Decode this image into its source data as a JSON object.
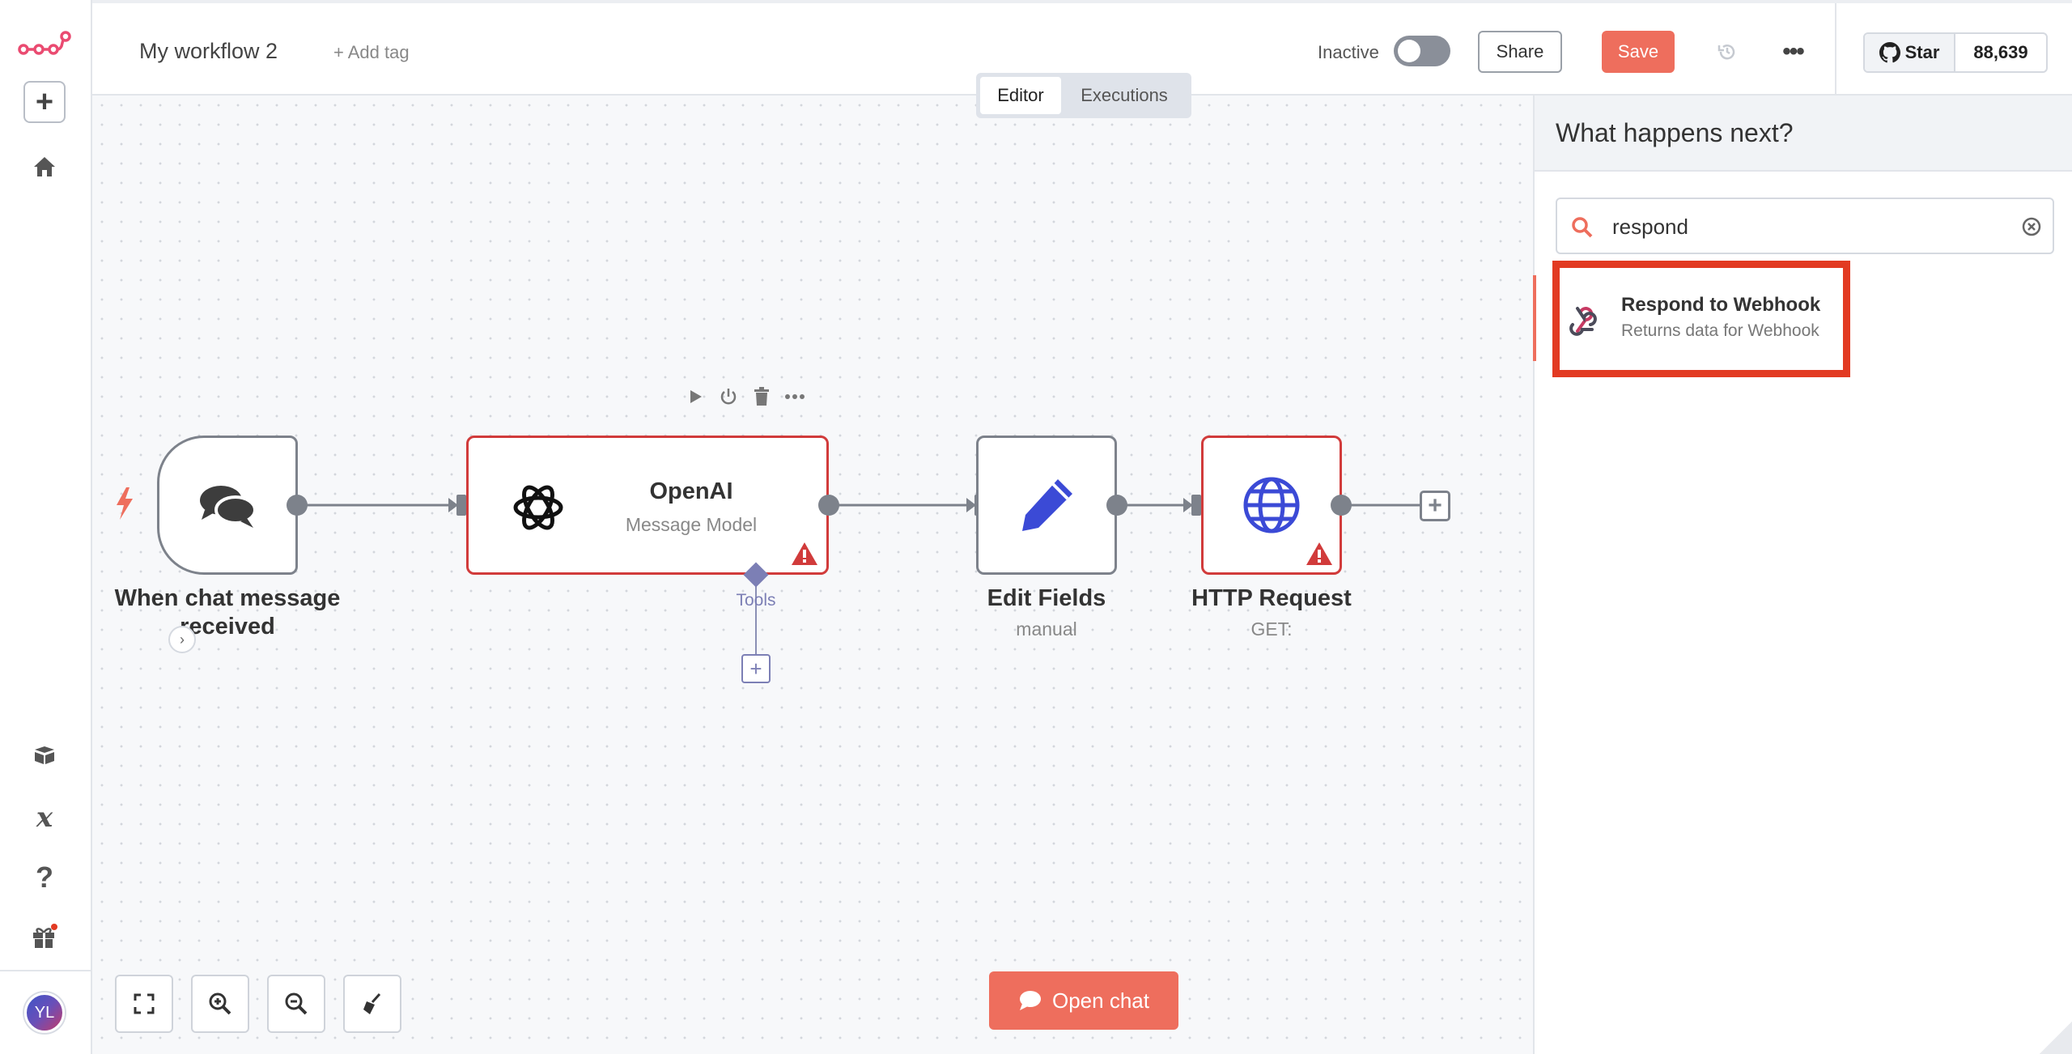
{
  "header": {
    "workflow_name": "My workflow 2",
    "add_tag": "+ Add tag",
    "status_label": "Inactive",
    "active": false,
    "share_label": "Share",
    "save_label": "Save",
    "more_label": "•••",
    "github": {
      "star_label": "Star",
      "star_count": "88,639"
    }
  },
  "tabs": [
    {
      "label": "Editor",
      "active": true
    },
    {
      "label": "Executions",
      "active": false
    }
  ],
  "sidebar": {
    "avatar_initials": "YL",
    "items": [
      "logo",
      "add",
      "home",
      "templates",
      "variables",
      "help",
      "whats-new"
    ]
  },
  "nodes": [
    {
      "id": "chat-trigger",
      "label": "When chat message received",
      "icon": "chat-bubbles-icon",
      "error": false
    },
    {
      "id": "openai",
      "title": "OpenAI",
      "subtitle": "Message Model",
      "icon": "openai-icon",
      "error": true,
      "tools_label": "Tools"
    },
    {
      "id": "edit-fields",
      "label": "Edit Fields",
      "subtitle": "manual",
      "icon": "pencil-icon",
      "error": false
    },
    {
      "id": "http-request",
      "label": "HTTP Request",
      "subtitle": "GET:",
      "icon": "globe-icon",
      "error": true
    }
  ],
  "canvas": {
    "open_chat_label": "Open chat",
    "controls": [
      "fit-view",
      "zoom-in",
      "zoom-out",
      "tidy-up"
    ]
  },
  "panel": {
    "title": "What happens next?",
    "search_value": "respond",
    "results": [
      {
        "title": "Respond to Webhook",
        "description": "Returns data for Webhook",
        "icon": "webhook-icon"
      }
    ]
  },
  "colors": {
    "brand": "#ea4b71",
    "accent": "#ee6e5d",
    "error": "#d13b3b",
    "node_icon_blue": "#3b4ad6",
    "highlight": "#e23a22"
  }
}
